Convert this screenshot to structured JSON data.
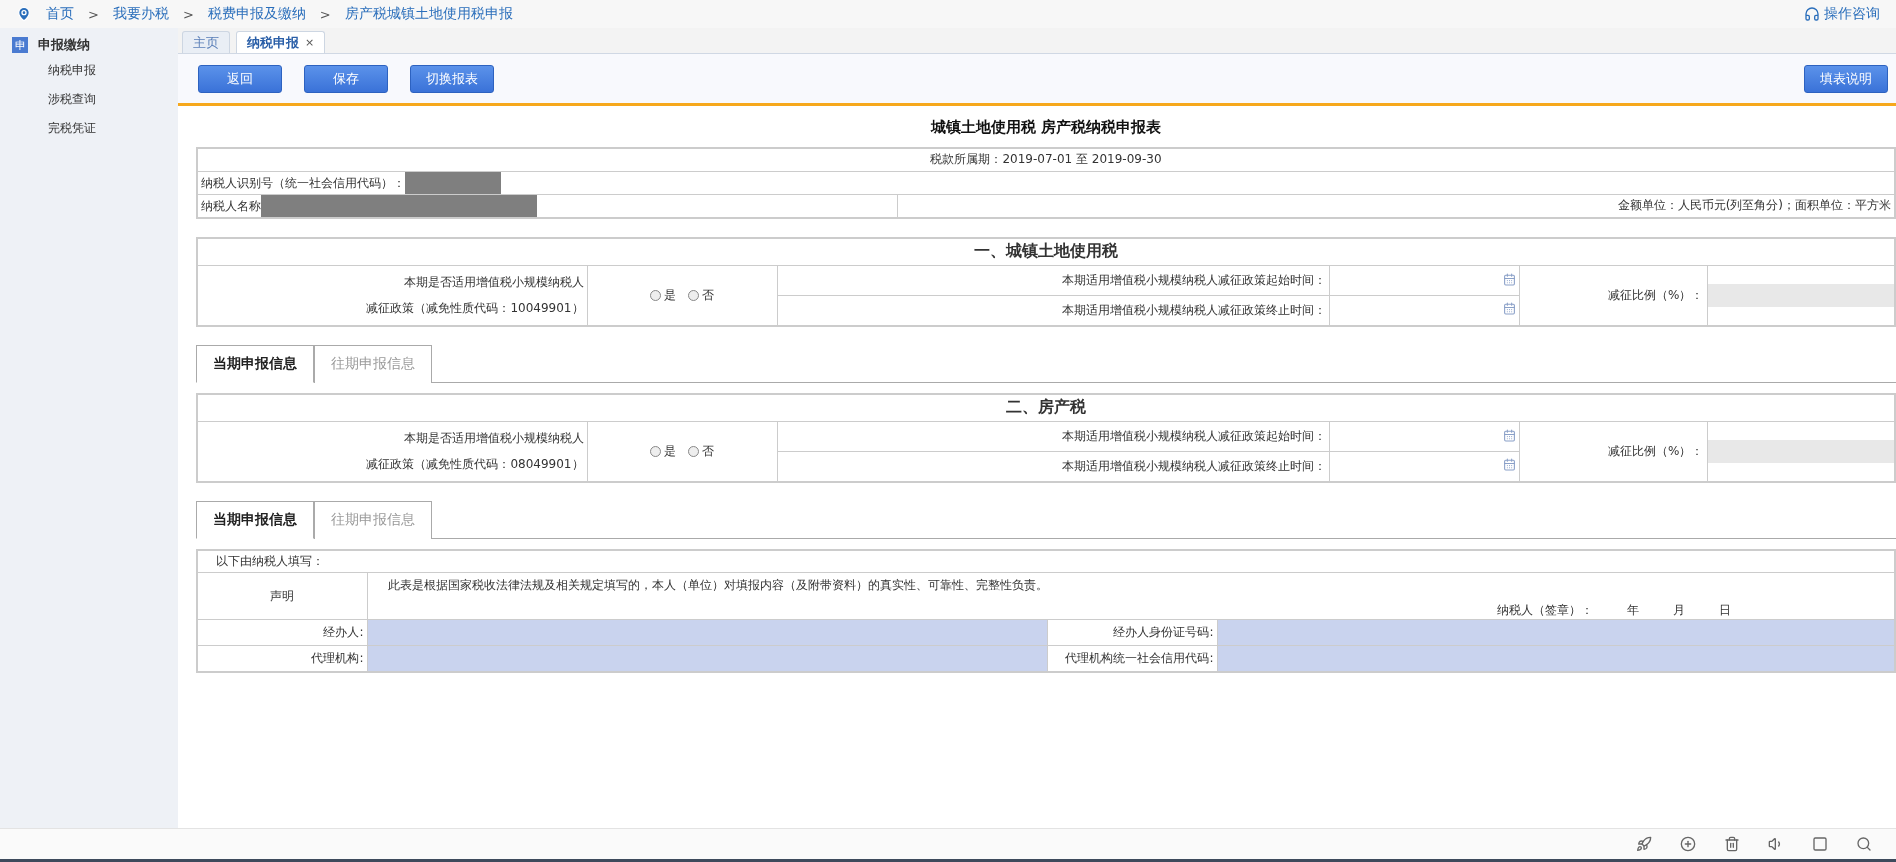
{
  "breadcrumb": [
    "首页",
    "我要办税",
    "税费申报及缴纳",
    "房产税城镇土地使用税申报"
  ],
  "breadcrumb_separator": ">",
  "help_link": "操作咨询",
  "sidebar": {
    "badge": "申",
    "title": "申报缴纳",
    "items": [
      {
        "label": "纳税申报",
        "selected": false
      },
      {
        "label": "涉税查询",
        "selected": false
      },
      {
        "label": "完税凭证",
        "selected": false
      }
    ]
  },
  "tabs": [
    {
      "label": "主页",
      "selected": false,
      "closable": false
    },
    {
      "label": "纳税申报",
      "selected": true,
      "closable": true,
      "close": "×"
    }
  ],
  "toolbar": {
    "left": [
      "返回",
      "保存",
      "切换报表"
    ],
    "right": "填表说明"
  },
  "form": {
    "title": "城镇土地使用税 房产税纳税申报表",
    "period": "税款所属期：2019-07-01 至 2019-09-30",
    "taxpayer_id_label": "纳税人识别号（统一社会信用代码）：",
    "taxpayer_name_label": "纳税人名称",
    "units": "金额单位：人民币元(列至角分)；面积单位：平方米",
    "sections": [
      {
        "heading": "一、城镇土地使用税",
        "question": "本期是否适用增值税小规模纳税人",
        "policy": "减征政策（减免性质代码：10049901）",
        "options": [
          {
            "label": "是",
            "selected": false
          },
          {
            "label": "否",
            "selected": false
          }
        ],
        "start_label": "本期适用增值税小规模纳税人减征政策起始时间：",
        "end_label": "本期适用增值税小规模纳税人减征政策终止时间：",
        "ratio_label": "减征比例（%）：",
        "subtabs": [
          {
            "label": "当期申报信息",
            "selected": true
          },
          {
            "label": "往期申报信息",
            "selected": false
          }
        ]
      },
      {
        "heading": "二、房产税",
        "question": "本期是否适用增值税小规模纳税人",
        "policy": "减征政策（减免性质代码：08049901）",
        "options": [
          {
            "label": "是",
            "selected": false
          },
          {
            "label": "否",
            "selected": false
          }
        ],
        "start_label": "本期适用增值税小规模纳税人减征政策起始时间：",
        "end_label": "本期适用增值税小规模纳税人减征政策终止时间：",
        "ratio_label": "减征比例（%）：",
        "subtabs": [
          {
            "label": "当期申报信息",
            "selected": true
          },
          {
            "label": "往期申报信息",
            "selected": false
          }
        ]
      }
    ],
    "declaration": {
      "intro": "以下由纳税人填写：",
      "label": "声明",
      "text": "此表是根据国家税收法律法规及相关规定填写的，本人（单位）对填报内容（及附带资料）的真实性、可靠性、完整性负责。",
      "signature": "纳税人（签章）：",
      "year": "年",
      "month": "月",
      "day": "日",
      "fields": [
        [
          "经办人:",
          "经办人身份证号码:"
        ],
        [
          "代理机构:",
          "代理机构统一社会信用代码:"
        ]
      ]
    }
  }
}
